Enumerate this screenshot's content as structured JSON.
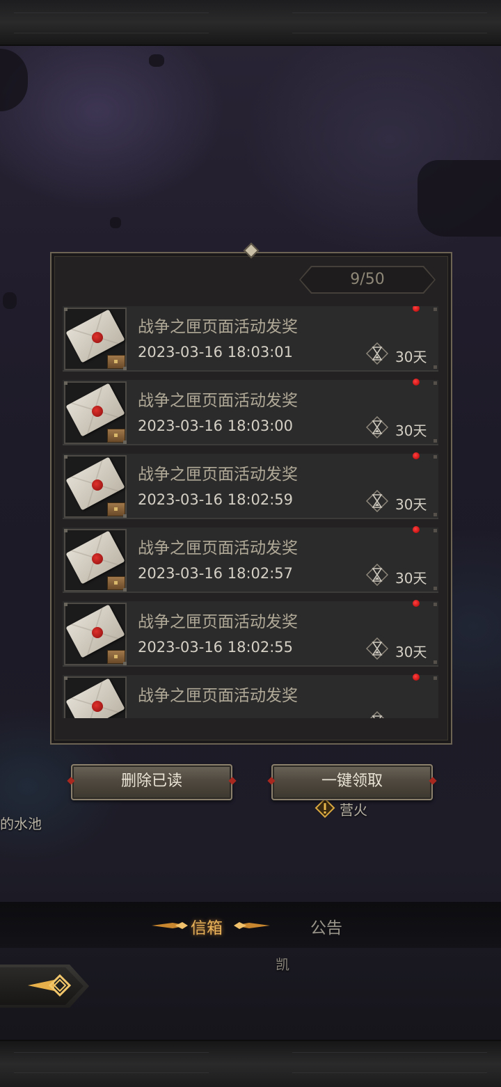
{
  "colors": {
    "panel_bg": "#232121",
    "panel_border": "#6e6454",
    "title_text": "#b0a998",
    "time_text": "#d5d0c6",
    "unread_dot": "#e02020",
    "tab_active": "#e9b45a",
    "tab_inactive": "#9a958b"
  },
  "mailbox": {
    "counter": "9/50",
    "mails": [
      {
        "title": "战争之匣页面活动发奖",
        "time": "2023-03-16 18:03:01",
        "expire": "30天",
        "unread": true,
        "icon": "envelope-icon"
      },
      {
        "title": "战争之匣页面活动发奖",
        "time": "2023-03-16 18:03:00",
        "expire": "30天",
        "unread": true,
        "icon": "envelope-icon"
      },
      {
        "title": "战争之匣页面活动发奖",
        "time": "2023-03-16 18:02:59",
        "expire": "30天",
        "unread": true,
        "icon": "envelope-icon"
      },
      {
        "title": "战争之匣页面活动发奖",
        "time": "2023-03-16 18:02:57",
        "expire": "30天",
        "unread": true,
        "icon": "envelope-icon"
      },
      {
        "title": "战争之匣页面活动发奖",
        "time": "2023-03-16 18:02:55",
        "expire": "30天",
        "unread": true,
        "icon": "envelope-icon"
      },
      {
        "title": "战争之匣页面活动发奖",
        "time": "",
        "expire": "",
        "unread": true,
        "icon": "envelope-icon"
      }
    ]
  },
  "actions": {
    "delete_read": "删除已读",
    "claim_all": "一键领取"
  },
  "tabs": {
    "mailbox": "信箱",
    "announcement": "公告"
  },
  "map_labels": {
    "pool": "的水池",
    "campfire": "营火",
    "kai": "凯"
  }
}
